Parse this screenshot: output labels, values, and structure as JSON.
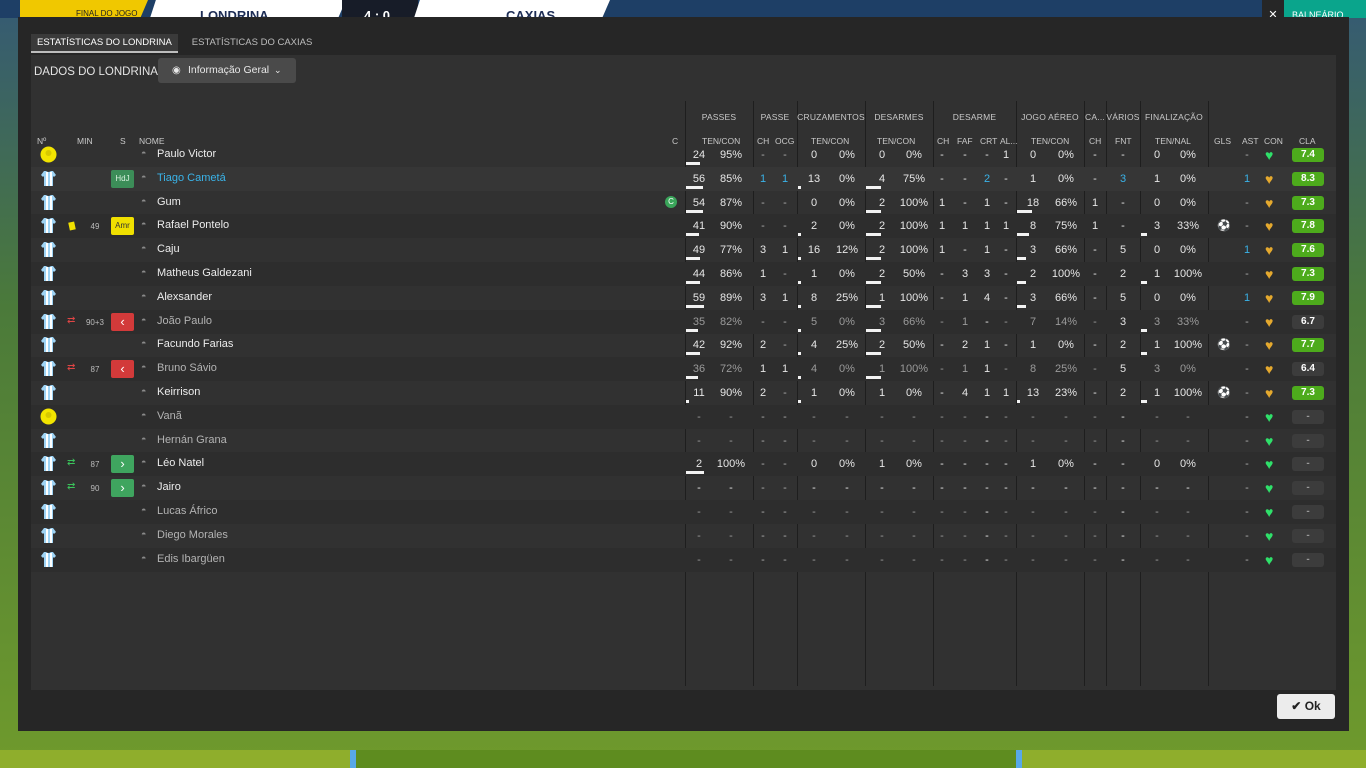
{
  "topbar": {
    "status": "FINAL DO JOGO",
    "home": "LONDRINA",
    "score": "4 : 0",
    "away": "CAXIAS",
    "button": "BALNEÁRIO",
    "close": "✕"
  },
  "tabs": [
    {
      "label": "ESTATÍSTICAS DO LONDRINA"
    },
    {
      "label": "ESTATÍSTICAS DO CAXIAS"
    }
  ],
  "subtitle": "DADOS DO LONDRINA",
  "dropdown": {
    "label": "Informação Geral"
  },
  "groups": [
    "PASSES",
    "PASSE",
    "CRUZAMENTOS",
    "DESARMES",
    "DESARME",
    "JOGO AÉREO",
    "CA...",
    "VÁRIOS",
    "FINALIZAÇÃO"
  ],
  "columns": {
    "num": "Nº",
    "min": "MIN",
    "s": "S",
    "name": "NOME",
    "c": "C",
    "passes": "TEN/CON",
    "passe_ch": "CH",
    "passe_ocg": "OCG",
    "cruz": "TEN/CON",
    "desarmes": "TEN/CON",
    "des_ch": "CH",
    "des_faf": "FAF",
    "des_crt": "CRT",
    "des_al": "AL...",
    "aereo": "TEN/CON",
    "ca_ch": "CH",
    "varios_fnt": "FNT",
    "final": "TEN/NAL",
    "gls": "GLS",
    "ast": "AST",
    "con": "CON",
    "cla": "CLA"
  },
  "ok_label": "Ok",
  "colors": {
    "green_rating": "#4dab1c",
    "heart_green": "#2fe06a",
    "heart_gold": "#e5a92e",
    "captain": "#3aa55a",
    "yellow": "#f0e000",
    "red": "#d23a3a"
  },
  "players": [
    {
      "shirt": "gk",
      "min": "",
      "s": "",
      "name": "Paulo Victor",
      "c": "",
      "p": [
        "24",
        "95%"
      ],
      "pch": "-",
      "pocg": "-",
      "cz": [
        "0",
        "0%"
      ],
      "ds": [
        "0",
        "0%"
      ],
      "dch": "-",
      "dfaf": "-",
      "dcrt": "-",
      "dal": "1",
      "ae": [
        "0",
        "0%"
      ],
      "cach": "-",
      "fnt": "-",
      "fi": [
        "0",
        "0%"
      ],
      "gls": "",
      "ast": "-",
      "con": "green",
      "cla": "7.4",
      "pbar": 0.7,
      "dbar": 0,
      "aebar": 0,
      "fbar": 0
    },
    {
      "shirt": "field",
      "min": "",
      "s": "HdJ",
      "name": "Tiago Cametá",
      "c": "",
      "p": [
        "56",
        "85%"
      ],
      "pch": "1",
      "pocg": "1",
      "cz": [
        "13",
        "0%"
      ],
      "ds": [
        "4",
        "75%"
      ],
      "dch": "-",
      "dfaf": "-",
      "dcrt": "2",
      "dal": "-",
      "ae": [
        "1",
        "0%"
      ],
      "cach": "-",
      "fnt": "3",
      "fi": [
        "1",
        "0%"
      ],
      "gls": "",
      "ast": "1",
      "con": "gold",
      "cla": "8.3",
      "pbar": 0.85,
      "dbar": 0.3,
      "aebar": 0,
      "fbar": 0
    },
    {
      "shirt": "field",
      "min": "",
      "s": "",
      "name": "Gum",
      "c": "C",
      "p": [
        "54",
        "87%"
      ],
      "pch": "-",
      "pocg": "-",
      "cz": [
        "0",
        "0%"
      ],
      "ds": [
        "2",
        "100%"
      ],
      "dch": "1",
      "dfaf": "-",
      "dcrt": "1",
      "dal": "-",
      "ae": [
        "18",
        "66%"
      ],
      "cach": "1",
      "fnt": "-",
      "fi": [
        "0",
        "0%"
      ],
      "gls": "",
      "ast": "-",
      "con": "gold",
      "cla": "7.3",
      "pbar": 0.85,
      "dbar": 0.3,
      "aebar": 0.25,
      "fbar": 0
    },
    {
      "shirt": "field",
      "min": "49",
      "s": "Amr",
      "name": "Rafael Pontelo",
      "c": "",
      "p": [
        "41",
        "90%"
      ],
      "pch": "-",
      "pocg": "-",
      "cz": [
        "2",
        "0%"
      ],
      "ds": [
        "2",
        "100%"
      ],
      "dch": "1",
      "dfaf": "1",
      "dcrt": "1",
      "dal": "1",
      "ae": [
        "8",
        "75%"
      ],
      "cach": "1",
      "fnt": "-",
      "fi": [
        "3",
        "33%"
      ],
      "gls": "ball",
      "ast": "-",
      "con": "gold",
      "cla": "7.8",
      "pbar": 0.65,
      "dbar": 0.3,
      "aebar": 0.2,
      "fbar": 0.2
    },
    {
      "shirt": "field",
      "min": "",
      "s": "",
      "name": "Caju",
      "c": "",
      "p": [
        "49",
        "77%"
      ],
      "pch": "3",
      "pocg": "1",
      "cz": [
        "16",
        "12%"
      ],
      "ds": [
        "2",
        "100%"
      ],
      "dch": "1",
      "dfaf": "-",
      "dcrt": "1",
      "dal": "-",
      "ae": [
        "3",
        "66%"
      ],
      "cach": "-",
      "fnt": "5",
      "fi": [
        "0",
        "0%"
      ],
      "gls": "",
      "ast": "1",
      "con": "gold",
      "cla": "7.6",
      "pbar": 0.7,
      "dbar": 0.3,
      "aebar": 0.15,
      "fbar": 0
    },
    {
      "shirt": "field",
      "min": "",
      "s": "",
      "name": "Matheus Galdezani",
      "c": "",
      "p": [
        "44",
        "86%"
      ],
      "pch": "1",
      "pocg": "-",
      "cz": [
        "1",
        "0%"
      ],
      "ds": [
        "2",
        "50%"
      ],
      "dch": "-",
      "dfaf": "3",
      "dcrt": "3",
      "dal": "-",
      "ae": [
        "2",
        "100%"
      ],
      "cach": "-",
      "fnt": "2",
      "fi": [
        "1",
        "100%"
      ],
      "gls": "",
      "ast": "-",
      "con": "gold",
      "cla": "7.3",
      "pbar": 0.7,
      "dbar": 0.3,
      "aebar": 0.15,
      "fbar": 0.2
    },
    {
      "shirt": "field",
      "min": "",
      "s": "",
      "name": "Alexsander",
      "c": "",
      "p": [
        "59",
        "89%"
      ],
      "pch": "3",
      "pocg": "1",
      "cz": [
        "8",
        "25%"
      ],
      "ds": [
        "1",
        "100%"
      ],
      "dch": "-",
      "dfaf": "1",
      "dcrt": "4",
      "dal": "-",
      "ae": [
        "3",
        "66%"
      ],
      "cach": "-",
      "fnt": "5",
      "fi": [
        "0",
        "0%"
      ],
      "gls": "",
      "ast": "1",
      "con": "gold",
      "cla": "7.9",
      "pbar": 0.9,
      "dbar": 0.3,
      "aebar": 0.15,
      "fbar": 0
    },
    {
      "shirt": "field",
      "min": "90+3",
      "s": "out",
      "name": "João Paulo",
      "c": "",
      "dim": true,
      "p": [
        "35",
        "82%"
      ],
      "pch": "-",
      "pocg": "-",
      "cz": [
        "5",
        "0%"
      ],
      "ds": [
        "3",
        "66%"
      ],
      "dch": "-",
      "dfaf": "1",
      "dcrt": "-",
      "dal": "-",
      "ae": [
        "7",
        "14%"
      ],
      "cach": "-",
      "fnt": "3",
      "fi": [
        "3",
        "33%"
      ],
      "gls": "",
      "ast": "-",
      "con": "gold",
      "cla": "6.7",
      "pbar": 0.6,
      "dbar": 0.3,
      "aebar": 0,
      "fbar": 0.2
    },
    {
      "shirt": "field",
      "min": "",
      "s": "",
      "name": "Facundo Farias",
      "c": "",
      "p": [
        "42",
        "92%"
      ],
      "pch": "2",
      "pocg": "-",
      "cz": [
        "4",
        "25%"
      ],
      "ds": [
        "2",
        "50%"
      ],
      "dch": "-",
      "dfaf": "2",
      "dcrt": "1",
      "dal": "-",
      "ae": [
        "1",
        "0%"
      ],
      "cach": "-",
      "fnt": "2",
      "fi": [
        "1",
        "100%"
      ],
      "gls": "ball",
      "ast": "-",
      "con": "gold",
      "cla": "7.7",
      "pbar": 0.7,
      "dbar": 0.3,
      "aebar": 0,
      "fbar": 0.2
    },
    {
      "shirt": "field",
      "min": "87",
      "s": "out",
      "name": "Bruno Sávio",
      "c": "",
      "dim": true,
      "p": [
        "36",
        "72%"
      ],
      "pch": "1",
      "pocg": "1",
      "cz": [
        "4",
        "0%"
      ],
      "ds": [
        "1",
        "100%"
      ],
      "dch": "-",
      "dfaf": "1",
      "dcrt": "1",
      "dal": "-",
      "ae": [
        "8",
        "25%"
      ],
      "cach": "-",
      "fnt": "5",
      "fi": [
        "3",
        "0%"
      ],
      "gls": "",
      "ast": "-",
      "con": "gold",
      "cla": "6.4",
      "pbar": 0.6,
      "dbar": 0.3,
      "aebar": 0,
      "fbar": 0
    },
    {
      "shirt": "field",
      "min": "",
      "s": "",
      "name": "Keirrison",
      "c": "",
      "p": [
        "11",
        "90%"
      ],
      "pch": "2",
      "pocg": "-",
      "cz": [
        "1",
        "0%"
      ],
      "ds": [
        "1",
        "0%"
      ],
      "dch": "-",
      "dfaf": "4",
      "dcrt": "1",
      "dal": "1",
      "ae": [
        "13",
        "23%"
      ],
      "cach": "-",
      "fnt": "2",
      "fi": [
        "1",
        "100%"
      ],
      "gls": "ball",
      "ast": "-",
      "con": "gold",
      "cla": "7.3",
      "pbar": 0.15,
      "dbar": 0,
      "aebar": 0.05,
      "fbar": 0.2
    },
    {
      "shirt": "gk",
      "min": "",
      "s": "",
      "name": "Vanã",
      "c": "",
      "dim": true,
      "p": [
        "-",
        "-"
      ],
      "pch": "-",
      "pocg": "-",
      "cz": [
        "-",
        "-"
      ],
      "ds": [
        "-",
        "-"
      ],
      "dch": "-",
      "dfaf": "-",
      "dcrt": "-",
      "dal": "-",
      "ae": [
        "-",
        "-"
      ],
      "cach": "-",
      "fnt": "-",
      "fi": [
        "-",
        "-"
      ],
      "gls": "",
      "ast": "-",
      "con": "green",
      "cla": "-",
      "pbar": 0,
      "dbar": 0,
      "aebar": 0,
      "fbar": 0
    },
    {
      "shirt": "field",
      "min": "",
      "s": "",
      "name": "Hernán Grana",
      "c": "",
      "dim": true,
      "p": [
        "-",
        "-"
      ],
      "pch": "-",
      "pocg": "-",
      "cz": [
        "-",
        "-"
      ],
      "ds": [
        "-",
        "-"
      ],
      "dch": "-",
      "dfaf": "-",
      "dcrt": "-",
      "dal": "-",
      "ae": [
        "-",
        "-"
      ],
      "cach": "-",
      "fnt": "-",
      "fi": [
        "-",
        "-"
      ],
      "gls": "",
      "ast": "-",
      "con": "green",
      "cla": "-",
      "pbar": 0,
      "dbar": 0,
      "aebar": 0,
      "fbar": 0
    },
    {
      "shirt": "field",
      "min": "87",
      "s": "in",
      "name": "Léo Natel",
      "c": "",
      "p": [
        "2",
        "100%"
      ],
      "pch": "-",
      "pocg": "-",
      "cz": [
        "0",
        "0%"
      ],
      "ds": [
        "1",
        "0%"
      ],
      "dch": "-",
      "dfaf": "-",
      "dcrt": "-",
      "dal": "-",
      "ae": [
        "1",
        "0%"
      ],
      "cach": "-",
      "fnt": "-",
      "fi": [
        "0",
        "0%"
      ],
      "gls": "",
      "ast": "-",
      "con": "green",
      "cla": "-",
      "pbar": 0.9,
      "dbar": 0,
      "aebar": 0,
      "fbar": 0
    },
    {
      "shirt": "field",
      "min": "90",
      "s": "in",
      "name": "Jairo",
      "c": "",
      "p": [
        "-",
        "-"
      ],
      "pch": "-",
      "pocg": "-",
      "cz": [
        "-",
        "-"
      ],
      "ds": [
        "-",
        "-"
      ],
      "dch": "-",
      "dfaf": "-",
      "dcrt": "-",
      "dal": "-",
      "ae": [
        "-",
        "-"
      ],
      "cach": "-",
      "fnt": "-",
      "fi": [
        "-",
        "-"
      ],
      "gls": "",
      "ast": "-",
      "con": "green",
      "cla": "-",
      "pbar": 0,
      "dbar": 0,
      "aebar": 0,
      "fbar": 0
    },
    {
      "shirt": "field",
      "min": "",
      "s": "",
      "name": "Lucas Áfrico",
      "c": "",
      "dim": true,
      "p": [
        "-",
        "-"
      ],
      "pch": "-",
      "pocg": "-",
      "cz": [
        "-",
        "-"
      ],
      "ds": [
        "-",
        "-"
      ],
      "dch": "-",
      "dfaf": "-",
      "dcrt": "-",
      "dal": "-",
      "ae": [
        "-",
        "-"
      ],
      "cach": "-",
      "fnt": "-",
      "fi": [
        "-",
        "-"
      ],
      "gls": "",
      "ast": "-",
      "con": "green",
      "cla": "-",
      "pbar": 0,
      "dbar": 0,
      "aebar": 0,
      "fbar": 0
    },
    {
      "shirt": "field",
      "min": "",
      "s": "",
      "name": "Diego Morales",
      "c": "",
      "dim": true,
      "p": [
        "-",
        "-"
      ],
      "pch": "-",
      "pocg": "-",
      "cz": [
        "-",
        "-"
      ],
      "ds": [
        "-",
        "-"
      ],
      "dch": "-",
      "dfaf": "-",
      "dcrt": "-",
      "dal": "-",
      "ae": [
        "-",
        "-"
      ],
      "cach": "-",
      "fnt": "-",
      "fi": [
        "-",
        "-"
      ],
      "gls": "",
      "ast": "-",
      "con": "green",
      "cla": "-",
      "pbar": 0,
      "dbar": 0,
      "aebar": 0,
      "fbar": 0
    },
    {
      "shirt": "field",
      "min": "",
      "s": "",
      "name": "Edis Ibargüen",
      "c": "",
      "dim": true,
      "p": [
        "-",
        "-"
      ],
      "pch": "-",
      "pocg": "-",
      "cz": [
        "-",
        "-"
      ],
      "ds": [
        "-",
        "-"
      ],
      "dch": "-",
      "dfaf": "-",
      "dcrt": "-",
      "dal": "-",
      "ae": [
        "-",
        "-"
      ],
      "cach": "-",
      "fnt": "-",
      "fi": [
        "-",
        "-"
      ],
      "gls": "",
      "ast": "-",
      "con": "green",
      "cla": "-",
      "pbar": 0,
      "dbar": 0,
      "aebar": 0,
      "fbar": 0
    }
  ]
}
